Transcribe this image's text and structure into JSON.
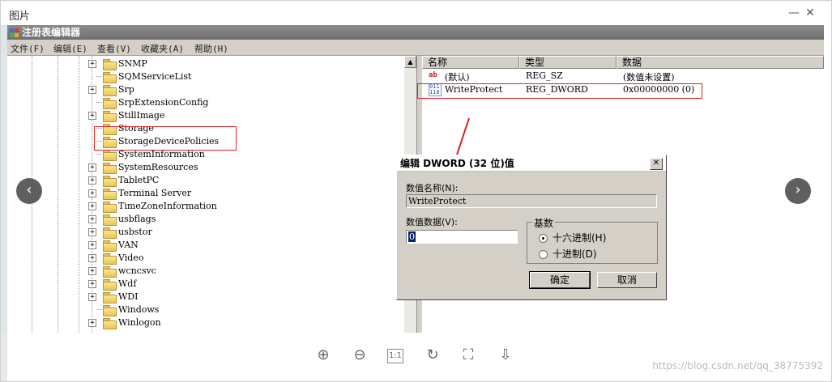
{
  "viewer": {
    "title": "图片",
    "minimize": "—",
    "close": "✕",
    "prev": "‹",
    "next": "›",
    "toolbar": [
      "⊕",
      "⊖",
      "1:1",
      "↻",
      "⛶",
      "⇩"
    ],
    "watermark": "https://blog.csdn.net/qq_38775392"
  },
  "regedit": {
    "title": "注册表编辑器",
    "menu": [
      "文件(F)",
      "编辑(E)",
      "查看(V)",
      "收藏夹(A)",
      "帮助(H)"
    ],
    "tree": [
      {
        "label": "SNMP",
        "expandable": true
      },
      {
        "label": "SQMServiceList",
        "expandable": false
      },
      {
        "label": "Srp",
        "expandable": true
      },
      {
        "label": "SrpExtensionConfig",
        "expandable": false
      },
      {
        "label": "StillImage",
        "expandable": true
      },
      {
        "label": "Storage",
        "expandable": false
      },
      {
        "label": "StorageDevicePolicies",
        "expandable": false
      },
      {
        "label": "SystemInformation",
        "expandable": false
      },
      {
        "label": "SystemResources",
        "expandable": true
      },
      {
        "label": "TabletPC",
        "expandable": true
      },
      {
        "label": "Terminal Server",
        "expandable": true
      },
      {
        "label": "TimeZoneInformation",
        "expandable": true
      },
      {
        "label": "usbflags",
        "expandable": true
      },
      {
        "label": "usbstor",
        "expandable": true
      },
      {
        "label": "VAN",
        "expandable": true
      },
      {
        "label": "Video",
        "expandable": true
      },
      {
        "label": "wcncsvc",
        "expandable": true
      },
      {
        "label": "Wdf",
        "expandable": true
      },
      {
        "label": "WDI",
        "expandable": true
      },
      {
        "label": "Windows",
        "expandable": false
      },
      {
        "label": "Winlogon",
        "expandable": true
      }
    ],
    "columns": [
      "名称",
      "类型",
      "数据"
    ],
    "values": [
      {
        "icon": "ab",
        "name": "(默认)",
        "type": "REG_SZ",
        "data": "(数值未设置)"
      },
      {
        "icon": "011\n110",
        "name": "WriteProtect",
        "type": "REG_DWORD",
        "data": "0x00000000 (0)"
      }
    ]
  },
  "dialog": {
    "title": "编辑 DWORD (32 位)值",
    "close": "✕",
    "name_label": "数值名称(N):",
    "name_value": "WriteProtect",
    "data_label": "数值数据(V):",
    "data_value": "0",
    "base_label": "基数",
    "hex_label": "十六进制(H)",
    "dec_label": "十进制(D)",
    "ok_label": "确定",
    "cancel_label": "取消"
  }
}
